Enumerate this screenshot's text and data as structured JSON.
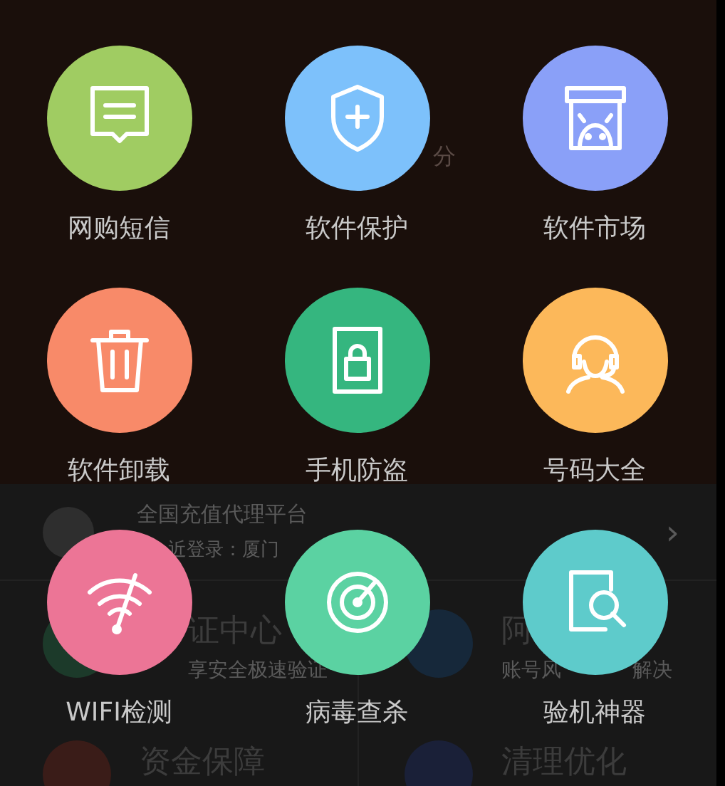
{
  "background": {
    "score_unit": "分",
    "account": {
      "title": "全国充值代理平台",
      "subtitle": "近登录：厦门",
      "chevron": "›"
    },
    "services": [
      {
        "title": "证中心",
        "subtitle": "享安全极速验证",
        "color": "#1c3a2a"
      },
      {
        "title": "阿",
        "subtitle": "账号风",
        "subtitle_end": "解决",
        "color": "#16283a"
      },
      {
        "title": "资金保障",
        "color": "#3a1c18"
      },
      {
        "title": "清理优化",
        "color": "#1a2038"
      }
    ]
  },
  "menu_items": [
    {
      "label": "网购短信",
      "kind": "message",
      "color": "#a0cc62"
    },
    {
      "label": "软件保护",
      "kind": "shield",
      "color": "#7dc1fb"
    },
    {
      "label": "软件市场",
      "kind": "market",
      "color": "#8aa0f8"
    },
    {
      "label": "软件卸载",
      "kind": "trash",
      "color": "#f88a69"
    },
    {
      "label": "手机防盗",
      "kind": "lock",
      "color": "#35b67f"
    },
    {
      "label": "号码大全",
      "kind": "headset",
      "color": "#fcb85a"
    },
    {
      "label": "WIFI检测",
      "kind": "wifi",
      "color": "#ec7596"
    },
    {
      "label": "病毒查杀",
      "kind": "radar",
      "color": "#5bd2a2"
    },
    {
      "label": "验机神器",
      "kind": "inspect",
      "color": "#5ecbcb"
    }
  ]
}
